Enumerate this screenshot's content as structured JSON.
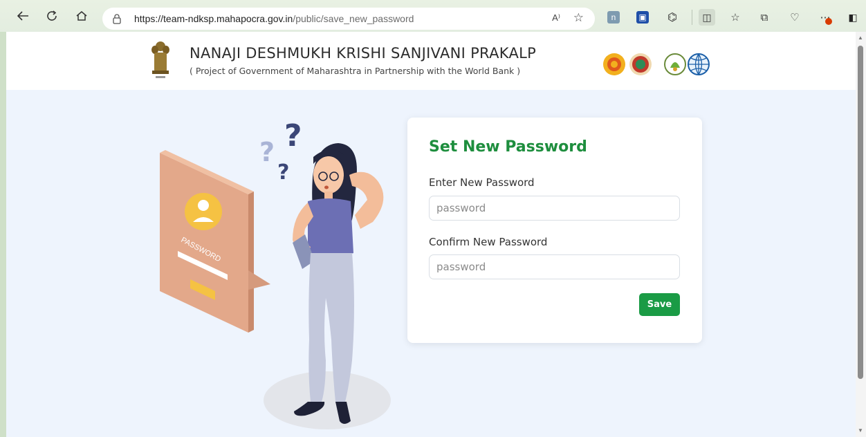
{
  "browser": {
    "url_host": "https://team-ndksp.mahapocra.gov.in",
    "url_path": "/public/save_new_password",
    "read_aloud_icon": "A⁾"
  },
  "header": {
    "title": "NANAJI DESHMUKH KRISHI SANJIVANI PRAKALP",
    "subtitle": "( Project of Government of Maharashtra in Partnership with the World Bank )"
  },
  "form": {
    "title": "Set New Password",
    "new_password_label": "Enter New Password",
    "new_password_placeholder": "password",
    "new_password_value": "",
    "confirm_password_label": "Confirm New Password",
    "confirm_password_placeholder": "password",
    "confirm_password_value": "",
    "save_label": "Save"
  },
  "colors": {
    "title_green": "#1e8e3e",
    "button_green": "#1a9b45",
    "page_bg": "#eef4fd"
  }
}
